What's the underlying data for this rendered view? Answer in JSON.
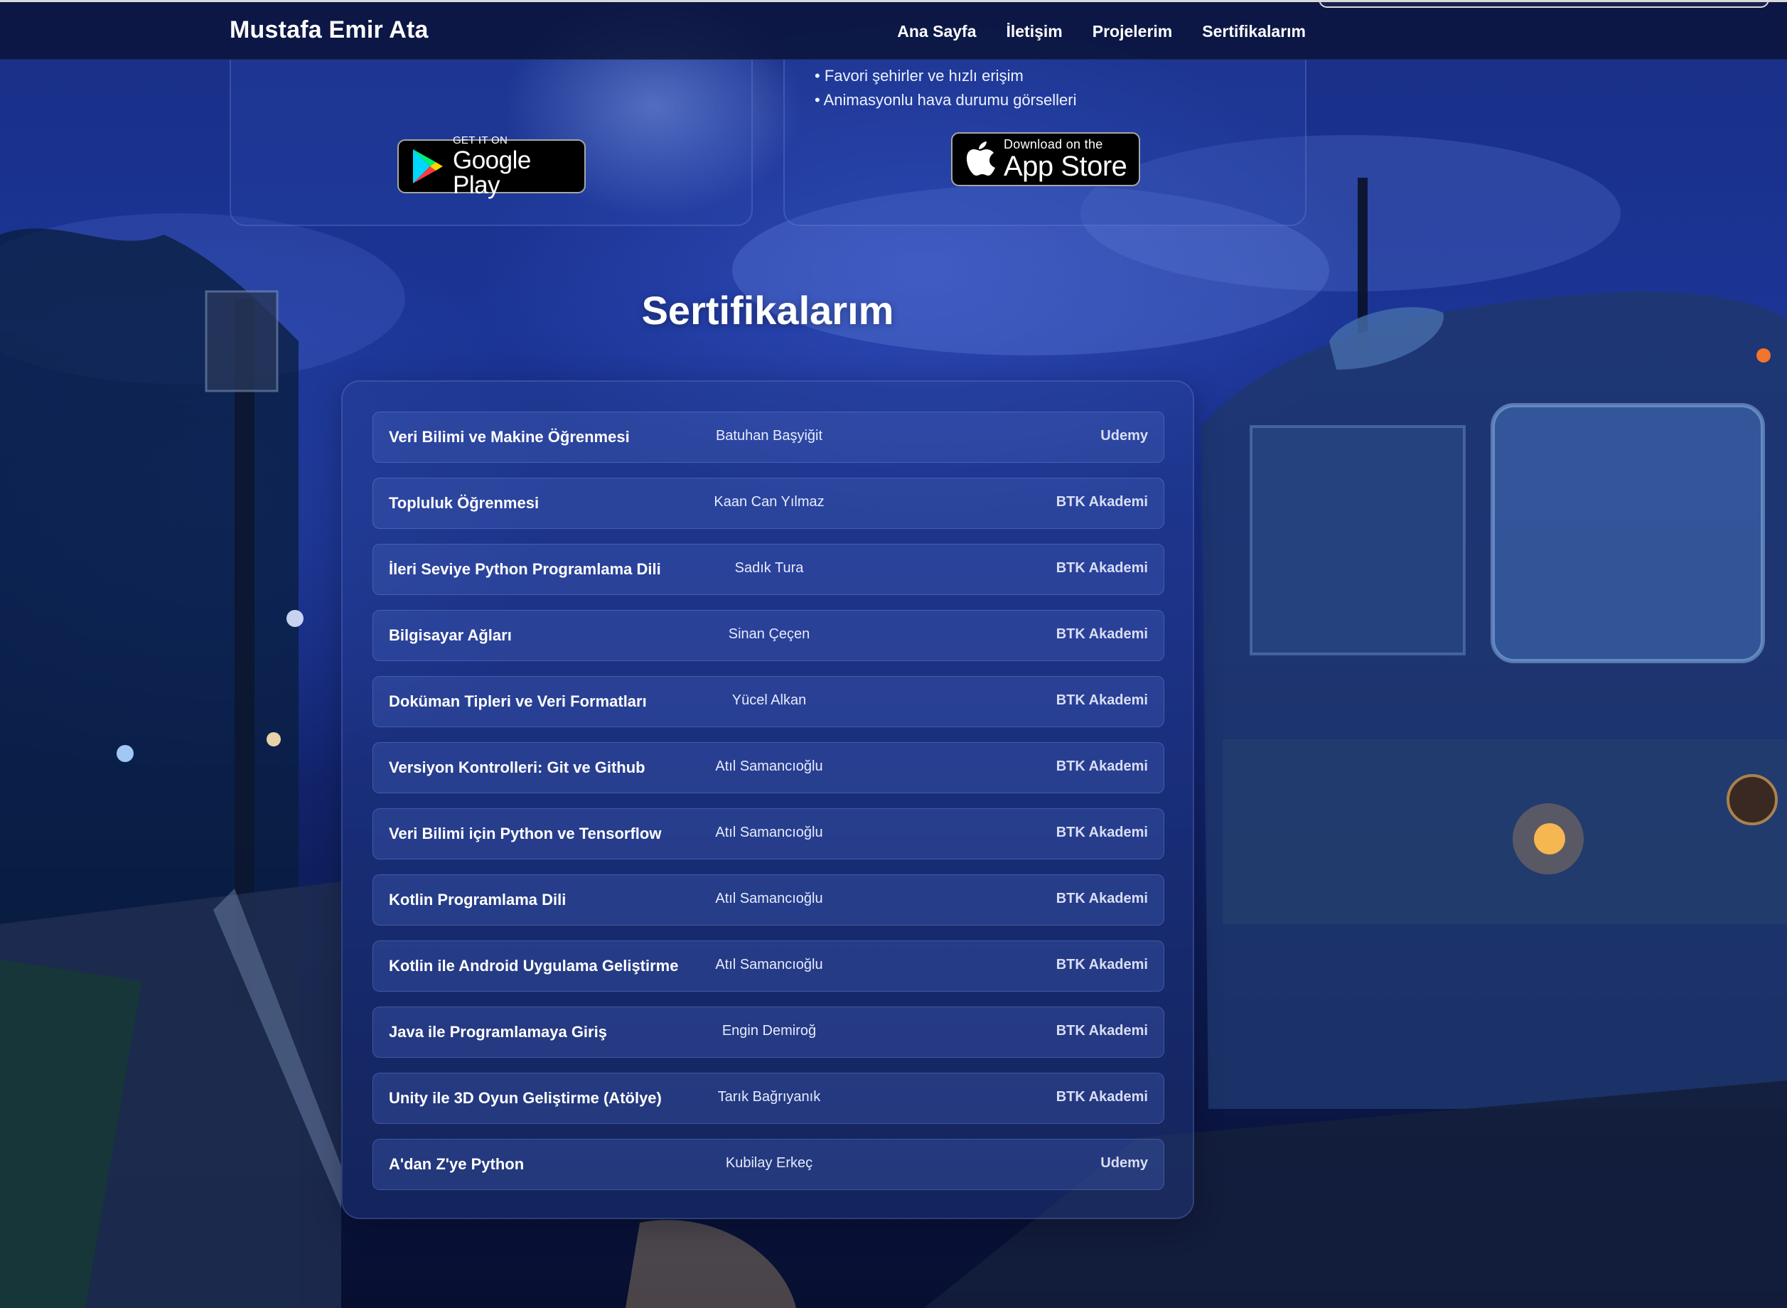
{
  "nav": {
    "brand": "Mustafa Emir Ata",
    "links": [
      "Ana Sayfa",
      "İletişim",
      "Projelerim",
      "Sertifikalarım"
    ]
  },
  "projects": {
    "right_features": [
      "Favori şehirler ve hızlı erişim",
      "Animasyonlu hava durumu görselleri"
    ],
    "google_badge": {
      "small": "GET IT ON",
      "big": "Google Play"
    },
    "apple_badge": {
      "small": "Download on the",
      "big": "App Store"
    }
  },
  "certificates": {
    "title": "Sertifikalarım",
    "items": [
      {
        "name": "Veri Bilimi ve Makine Öğrenmesi",
        "instructor": "Batuhan Başyiğit",
        "provider": "Udemy"
      },
      {
        "name": "Topluluk Öğrenmesi",
        "instructor": "Kaan Can Yılmaz",
        "provider": "BTK Akademi"
      },
      {
        "name": "İleri Seviye Python Programlama Dili",
        "instructor": "Sadık Tura",
        "provider": "BTK Akademi"
      },
      {
        "name": "Bilgisayar Ağları",
        "instructor": "Sinan Çeçen",
        "provider": "BTK Akademi"
      },
      {
        "name": "Doküman Tipleri ve Veri Formatları",
        "instructor": "Yücel Alkan",
        "provider": "BTK Akademi"
      },
      {
        "name": "Versiyon Kontrolleri: Git ve Github",
        "instructor": "Atıl Samancıoğlu",
        "provider": "BTK Akademi"
      },
      {
        "name": "Veri Bilimi için Python ve Tensorflow",
        "instructor": "Atıl Samancıoğlu",
        "provider": "BTK Akademi"
      },
      {
        "name": "Kotlin Programlama Dili",
        "instructor": "Atıl Samancıoğlu",
        "provider": "BTK Akademi"
      },
      {
        "name": "Kotlin ile Android Uygulama Geliştirme",
        "instructor": "Atıl Samancıoğlu",
        "provider": "BTK Akademi"
      },
      {
        "name": "Java ile Programlamaya Giriş",
        "instructor": "Engin Demiroğ",
        "provider": "BTK Akademi"
      },
      {
        "name": "Unity ile 3D Oyun Geliştirme (Atölye)",
        "instructor": "Tarık Bağrıyanık",
        "provider": "BTK Akademi"
      },
      {
        "name": "A'dan Z'ye Python",
        "instructor": "Kubilay Erkeç",
        "provider": "Udemy"
      }
    ]
  }
}
